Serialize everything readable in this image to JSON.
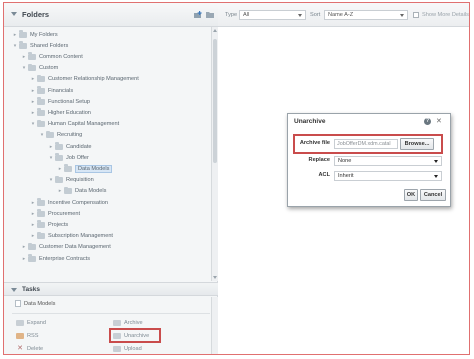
{
  "folders_panel": {
    "title": "Folders",
    "tree": [
      {
        "label": "My Folders",
        "indent": 0,
        "toggle": "▸",
        "kind": "folder"
      },
      {
        "label": "Shared Folders",
        "indent": 0,
        "toggle": "▾",
        "kind": "folder"
      },
      {
        "label": "Common Content",
        "indent": 1,
        "toggle": "▸",
        "kind": "folder"
      },
      {
        "label": "Custom",
        "indent": 1,
        "toggle": "▾",
        "kind": "folder"
      },
      {
        "label": "Customer Relationship Management",
        "indent": 2,
        "toggle": "▸",
        "kind": "folder"
      },
      {
        "label": "Financials",
        "indent": 2,
        "toggle": "▸",
        "kind": "folder"
      },
      {
        "label": "Functional Setup",
        "indent": 2,
        "toggle": "▸",
        "kind": "folder"
      },
      {
        "label": "Higher Education",
        "indent": 2,
        "toggle": "▸",
        "kind": "folder"
      },
      {
        "label": "Human Capital Management",
        "indent": 2,
        "toggle": "▾",
        "kind": "folder"
      },
      {
        "label": "Recruiting",
        "indent": 3,
        "toggle": "▾",
        "kind": "folder"
      },
      {
        "label": "Candidate",
        "indent": 4,
        "toggle": "▸",
        "kind": "folder"
      },
      {
        "label": "Job Offer",
        "indent": 4,
        "toggle": "▾",
        "kind": "folder"
      },
      {
        "label": "Data Models",
        "indent": 5,
        "toggle": "▸",
        "kind": "folder",
        "selected": true
      },
      {
        "label": "Requisition",
        "indent": 4,
        "toggle": "▾",
        "kind": "folder"
      },
      {
        "label": "Data Models",
        "indent": 5,
        "toggle": "▸",
        "kind": "folder"
      },
      {
        "label": "Incentive Compensation",
        "indent": 2,
        "toggle": "▸",
        "kind": "folder"
      },
      {
        "label": "Procurement",
        "indent": 2,
        "toggle": "▸",
        "kind": "folder"
      },
      {
        "label": "Projects",
        "indent": 2,
        "toggle": "▸",
        "kind": "folder"
      },
      {
        "label": "Subscription Management",
        "indent": 2,
        "toggle": "▸",
        "kind": "folder"
      },
      {
        "label": "Customer Data Management",
        "indent": 1,
        "toggle": "▸",
        "kind": "folder"
      },
      {
        "label": "Enterprise Contracts",
        "indent": 1,
        "toggle": "▸",
        "kind": "folder"
      }
    ]
  },
  "tasks_panel": {
    "title": "Tasks",
    "context": "Data Models",
    "items": {
      "expand": "Expand",
      "archive": "Archive",
      "rss": "RSS",
      "unarchive": "Unarchive",
      "delete": "Delete",
      "upload": "Upload"
    }
  },
  "toolbar": {
    "type_label": "Type",
    "type_value": "All",
    "sort_label": "Sort",
    "sort_value": "Name A-Z",
    "show_more_label": "Show More Details"
  },
  "dialog": {
    "title": "Unarchive",
    "archive_file_label": "Archive file",
    "archive_file_value": "JobOfferDM.xdm.catal",
    "browse_label": "Browse...",
    "replace_label": "Replace",
    "replace_value": "None",
    "acl_label": "ACL",
    "acl_value": "Inherit",
    "ok_label": "OK",
    "cancel_label": "Cancel"
  },
  "colors": {
    "highlight": "#c94c4c",
    "selection": "#d7e6f5",
    "panel_bg": "#f4f6f7"
  }
}
